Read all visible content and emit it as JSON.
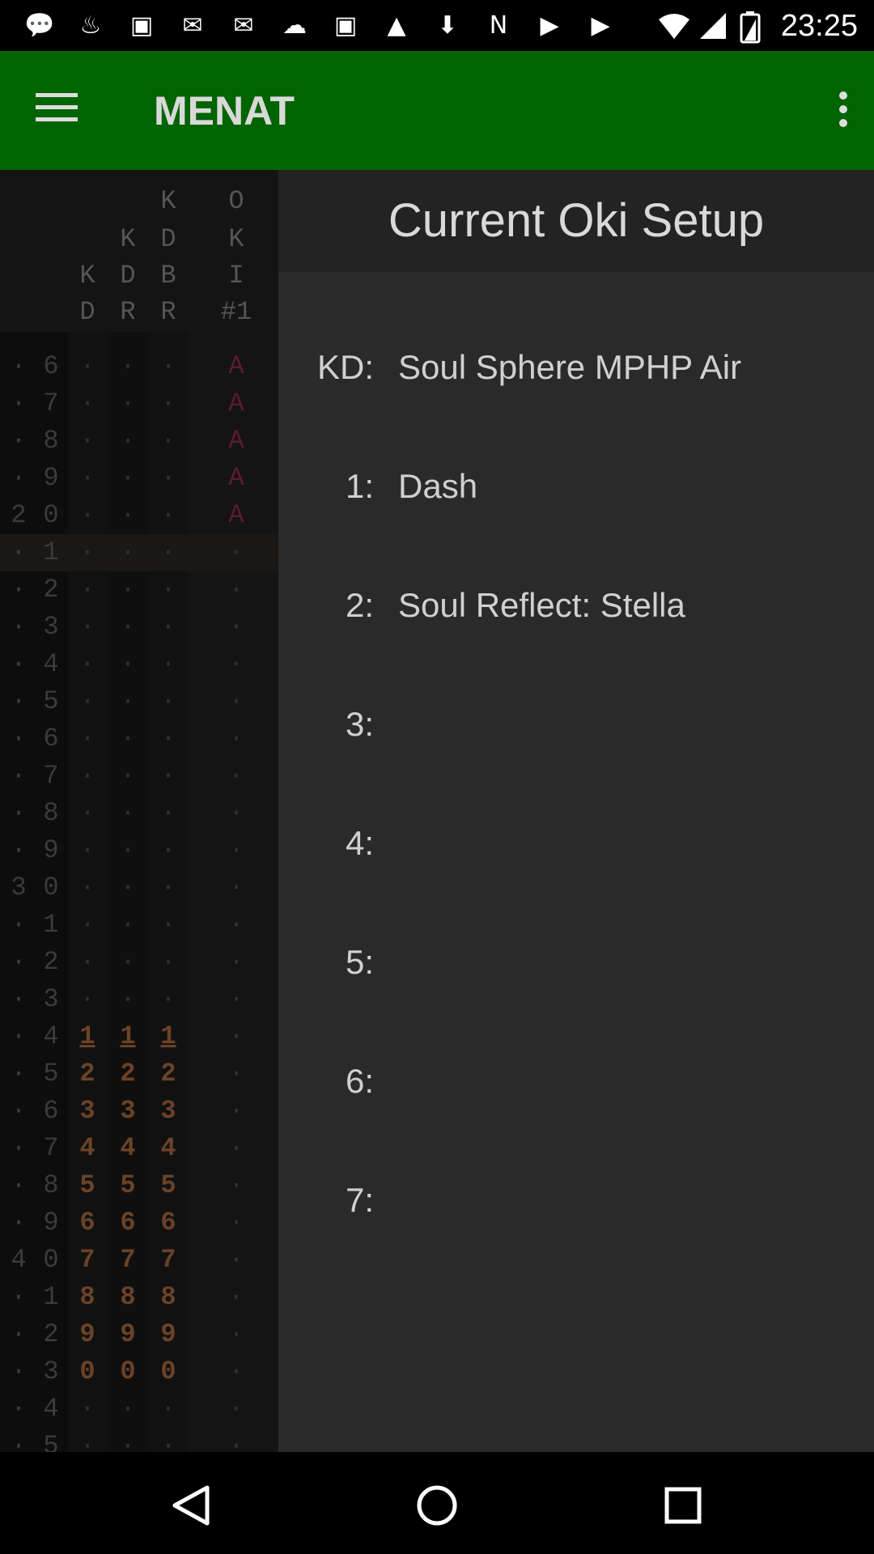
{
  "status_bar": {
    "time": "23:25",
    "icons": [
      "messages-icon",
      "steam-icon",
      "twitch-icon",
      "gmail-icon",
      "gmail-icon",
      "discord-icon",
      "twitch-icon",
      "image-icon",
      "download-icon",
      "n-icon",
      "youtube-icon",
      "youtube-icon"
    ]
  },
  "app_bar": {
    "title": "MENAT"
  },
  "grid": {
    "headers": [
      {
        "col": "KD",
        "lines": [
          "K",
          "D"
        ]
      },
      {
        "col": "KDR",
        "lines": [
          "K",
          "D",
          "R"
        ]
      },
      {
        "col": "KDBR",
        "lines": [
          "K",
          "D",
          "B",
          "R"
        ]
      },
      {
        "col": "OKI1",
        "lines": [
          "O",
          "K",
          "I",
          "#1"
        ]
      }
    ],
    "rows": [
      {
        "t": ".",
        "o": "6",
        "c1": ".",
        "c2": ".",
        "c3": ".",
        "c4": "A"
      },
      {
        "t": ".",
        "o": "7",
        "c1": ".",
        "c2": ".",
        "c3": ".",
        "c4": "A"
      },
      {
        "t": ".",
        "o": "8",
        "c1": ".",
        "c2": ".",
        "c3": ".",
        "c4": "A"
      },
      {
        "t": ".",
        "o": "9",
        "c1": ".",
        "c2": ".",
        "c3": ".",
        "c4": "A"
      },
      {
        "t": "2",
        "o": "0",
        "c1": ".",
        "c2": ".",
        "c3": ".",
        "c4": "A"
      },
      {
        "t": ".",
        "o": "1",
        "c1": ".",
        "c2": ".",
        "c3": ".",
        "c4": ".",
        "current": true
      },
      {
        "t": ".",
        "o": "2",
        "c1": ".",
        "c2": ".",
        "c3": ".",
        "c4": "."
      },
      {
        "t": ".",
        "o": "3",
        "c1": ".",
        "c2": ".",
        "c3": ".",
        "c4": "."
      },
      {
        "t": ".",
        "o": "4",
        "c1": ".",
        "c2": ".",
        "c3": ".",
        "c4": "."
      },
      {
        "t": ".",
        "o": "5",
        "c1": ".",
        "c2": ".",
        "c3": ".",
        "c4": "."
      },
      {
        "t": ".",
        "o": "6",
        "c1": ".",
        "c2": ".",
        "c3": ".",
        "c4": "."
      },
      {
        "t": ".",
        "o": "7",
        "c1": ".",
        "c2": ".",
        "c3": ".",
        "c4": "."
      },
      {
        "t": ".",
        "o": "8",
        "c1": ".",
        "c2": ".",
        "c3": ".",
        "c4": "."
      },
      {
        "t": ".",
        "o": "9",
        "c1": ".",
        "c2": ".",
        "c3": ".",
        "c4": "."
      },
      {
        "t": "3",
        "o": "0",
        "c1": ".",
        "c2": ".",
        "c3": ".",
        "c4": "."
      },
      {
        "t": ".",
        "o": "1",
        "c1": ".",
        "c2": ".",
        "c3": ".",
        "c4": "."
      },
      {
        "t": ".",
        "o": "2",
        "c1": ".",
        "c2": ".",
        "c3": ".",
        "c4": "."
      },
      {
        "t": ".",
        "o": "3",
        "c1": ".",
        "c2": ".",
        "c3": ".",
        "c4": "."
      },
      {
        "t": ".",
        "o": "4",
        "c1": "1",
        "c2": "1",
        "c3": "1",
        "c4": ".",
        "underline": true
      },
      {
        "t": ".",
        "o": "5",
        "c1": "2",
        "c2": "2",
        "c3": "2",
        "c4": "."
      },
      {
        "t": ".",
        "o": "6",
        "c1": "3",
        "c2": "3",
        "c3": "3",
        "c4": "."
      },
      {
        "t": ".",
        "o": "7",
        "c1": "4",
        "c2": "4",
        "c3": "4",
        "c4": "."
      },
      {
        "t": ".",
        "o": "8",
        "c1": "5",
        "c2": "5",
        "c3": "5",
        "c4": "."
      },
      {
        "t": ".",
        "o": "9",
        "c1": "6",
        "c2": "6",
        "c3": "6",
        "c4": "."
      },
      {
        "t": "4",
        "o": "0",
        "c1": "7",
        "c2": "7",
        "c3": "7",
        "c4": "."
      },
      {
        "t": ".",
        "o": "1",
        "c1": "8",
        "c2": "8",
        "c3": "8",
        "c4": "."
      },
      {
        "t": ".",
        "o": "2",
        "c1": "9",
        "c2": "9",
        "c3": "9",
        "c4": "."
      },
      {
        "t": ".",
        "o": "3",
        "c1": "0",
        "c2": "0",
        "c3": "0",
        "c4": "."
      },
      {
        "t": ".",
        "o": "4",
        "c1": ".",
        "c2": ".",
        "c3": ".",
        "c4": "."
      },
      {
        "t": ".",
        "o": "5",
        "c1": ".",
        "c2": ".",
        "c3": ".",
        "c4": "."
      }
    ]
  },
  "panel": {
    "title": "Current Oki Setup",
    "slots": [
      {
        "label": "KD:",
        "value": "Soul Sphere MPHP Air"
      },
      {
        "label": "1:",
        "value": "Dash"
      },
      {
        "label": "2:",
        "value": "Soul Reflect: Stella"
      },
      {
        "label": "3:",
        "value": ""
      },
      {
        "label": "4:",
        "value": ""
      },
      {
        "label": "5:",
        "value": ""
      },
      {
        "label": "6:",
        "value": ""
      },
      {
        "label": "7:",
        "value": ""
      }
    ]
  },
  "colors": {
    "app_bar": "#006400",
    "panel_bg": "#2a2a2a",
    "grid_bg": "#0d0d0d",
    "oki_marker": "#5c1a33",
    "frame_number": "#6b4226"
  }
}
